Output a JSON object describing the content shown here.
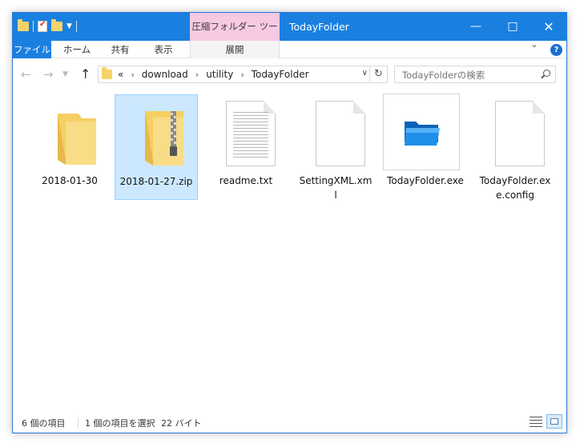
{
  "window": {
    "title": "TodayFolder",
    "tool_tab": "圧縮フォルダー ツール"
  },
  "window_controls": {
    "minimize": "—",
    "maximize": "□",
    "close": "✕"
  },
  "ribbon": {
    "file": "ファイル",
    "home": "ホーム",
    "share": "共有",
    "view": "表示",
    "manage": "展開",
    "help": "?"
  },
  "address": {
    "overflow": "«",
    "crumbs": [
      "download",
      "utility",
      "TodayFolder"
    ],
    "separator": "›"
  },
  "search": {
    "placeholder": "TodayFolderの検索"
  },
  "files": [
    {
      "name": "2018-01-30",
      "type": "folder",
      "selected": false
    },
    {
      "name": "2018-01-27.zip",
      "type": "zip",
      "selected": true
    },
    {
      "name": "readme.txt",
      "type": "text",
      "selected": false
    },
    {
      "name": "SettingXML.xml",
      "type": "xml",
      "selected": false
    },
    {
      "name": "TodayFolder.exe",
      "type": "exe",
      "selected": false
    },
    {
      "name": "TodayFolder.exe.config",
      "type": "config",
      "selected": false
    }
  ],
  "status": {
    "count": "6 個の項目",
    "selection": "1 個の項目を選択",
    "size": "22 バイト"
  },
  "colors": {
    "titlebar": "#1a80e0",
    "tool_tab": "#f8c9e2",
    "selection": "#cce8ff",
    "folder": "#f5d36a"
  }
}
